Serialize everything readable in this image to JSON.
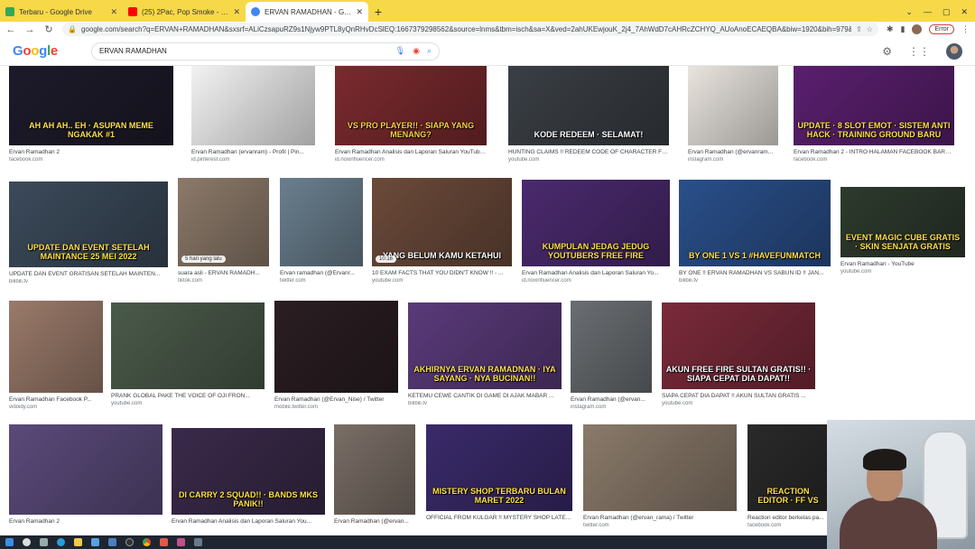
{
  "browser": {
    "tabs": [
      {
        "title": "Terbaru - Google Drive",
        "favicon_color": "#34a853"
      },
      {
        "title": "(25) 2Pac, Pop Smoke - Write Th",
        "favicon_color": "#ff0000"
      },
      {
        "title": "ERVAN RAMADHAN - Google Pe",
        "favicon_color": "#4285f4"
      }
    ],
    "new_tab": "+",
    "url": "google.com/search?q=ERVAN+RAMADHAN&sxsrf=ALiCzsapuRZ9s1Njyw9PTL8yQnRHvDcSlEQ:1667379298562&source=lnms&tbm=isch&sa=X&ved=2ahUKEwjouK_2j4_7AhWdD7cAHRcZCHYQ_AUoAnoECAEQBA&biw=1920&bih=979&dpr=1",
    "error_label": "Error"
  },
  "google": {
    "logo": [
      "G",
      "o",
      "o",
      "g",
      "l",
      "e"
    ],
    "query": "ERVAN RAMADHAN"
  },
  "results": [
    {
      "thumb_text": "AH AH AH.. EH · ASUPAN MEME NGAKAK #1",
      "caption": "Ervan Ramadhan 2",
      "source": "facebook.com",
      "bg": "#1d1b2a",
      "fg": "#ffe04a"
    },
    {
      "thumb_text": "",
      "caption": "Ervan Ramadhan (ervanram) - Profil | Pin...",
      "source": "id.pinterest.com",
      "bg": "#f2f2f2",
      "fg": "#333333"
    },
    {
      "thumb_text": "VS PRO PLAYER!! · SIAPA YANG MENANG?",
      "caption": "Ervan Ramadhan Analisis dan Laporan Saluran YouTube ...",
      "source": "id.noxinfluencer.com",
      "bg": "#7a2a2e",
      "fg": "#ffd23f"
    },
    {
      "thumb_text": "KODE REDEEM · SELAMAT!",
      "caption": "HUNTING CLAIMS !! REDEEM CODE OF CHARACTER FREE...",
      "source": "youtube.com",
      "bg": "#3a3f45",
      "fg": "#ffffff"
    },
    {
      "thumb_text": "",
      "caption": "Ervan Ramadhan (@ervanram...",
      "source": "instagram.com",
      "bg": "#e9e4de",
      "fg": "#333333"
    },
    {
      "thumb_text": "UPDATE · 8 SLOT EMOT · SISTEM ANTI HACK · TRAINING GROUND BARU",
      "caption": "Ervan Ramadhan 2 - INTRO HALAMAN FACEBOOK BARU E...",
      "source": "facebook.com",
      "bg": "#5a1f6e",
      "fg": "#ffe04a"
    },
    {
      "thumb_text": "UPDATE DAN EVENT SETELAH MAINTANCE 25 MEI 2022",
      "caption": "UPDATE DAN EVENT GRATISAN SETELAH MAINTEN...",
      "source": "bilibili.tv",
      "bg": "#3b4a5a",
      "fg": "#ffe04a"
    },
    {
      "thumb_text": "",
      "caption": "suara asli - ERVAN RAMADH...",
      "source": "tiktok.com",
      "bg": "#8c7a6a",
      "fg": "#ffffff",
      "badge": "5 hari yang lalu"
    },
    {
      "thumb_text": "",
      "caption": "Ervan ramadhan (@Ervanr...",
      "source": "twitter.com",
      "bg": "#6a7f8e",
      "fg": "#ffffff"
    },
    {
      "thumb_text": "YANG BELUM KAMU KETAHUI",
      "caption": "10 EXAM FACTS THAT YOU DIDN'T KNOW !! - ...",
      "source": "youtube.com",
      "bg": "#6b4a3a",
      "fg": "#ffffff",
      "badge": "10:16"
    },
    {
      "thumb_text": "KUMPULAN JEDAG JEDUG YOUTUBERS FREE FIRE",
      "caption": "Ervan Ramadhan Analisis dan Laporan Saluran Yo...",
      "source": "id.noxinfluencer.com",
      "bg": "#4a2a6e",
      "fg": "#ffe04a"
    },
    {
      "thumb_text": "BY ONE 1 VS 1 #HAVEFUNMATCH",
      "caption": "BY ONE !! ERVAN RAMADHAN VS SABUN ID !! JAN...",
      "source": "bilibili.tv",
      "bg": "#2a4f8a",
      "fg": "#ffe04a"
    },
    {
      "thumb_text": "EVENT MAGIC CUBE GRATIS · SKIN SENJATA GRATIS",
      "caption": "Ervan Ramadhan - YouTube",
      "source": "youtube.com",
      "bg": "#2e3a2e",
      "fg": "#ffe04a"
    },
    {
      "thumb_text": "",
      "caption": "Ervan Ramadhan Facebook P...",
      "source": "vidoidy.com",
      "bg": "#9a7a6a",
      "fg": "#ffffff"
    },
    {
      "thumb_text": "",
      "caption": "PRANK GLOBAL PAKE THE VOICE OF OJI FRON...",
      "source": "youtube.com",
      "bg": "#4a5a4a",
      "fg": "#ffffff"
    },
    {
      "thumb_text": "",
      "caption": "Ervan Ramadhan (@Ervan_Nise) / Twitter",
      "source": "mobile.twitter.com",
      "bg": "#2a1e22",
      "fg": "#ffffff"
    },
    {
      "thumb_text": "AKHIRNYA ERVAN RAMADNAN · IYA SAYANG · NYA BUCINAN!!",
      "caption": "KETEMU CEWE CANTIK DI GAME DI AJAK MABAR ...",
      "source": "bilibili.tv",
      "bg": "#5a3a7a",
      "fg": "#ffe04a"
    },
    {
      "thumb_text": "",
      "caption": "Ervan Ramadhan (@ervan...",
      "source": "instagram.com",
      "bg": "#6a6e72",
      "fg": "#ffffff"
    },
    {
      "thumb_text": "AKUN FREE FIRE SULTAN GRATIS!! · SIAPA CEPAT DIA DAPAT!!",
      "caption": "SIAPA CEPAT DIA DAPAT !! AKUN SULTAN GRATIS ...",
      "source": "youtube.com",
      "bg": "#7a2a3a",
      "fg": "#ffffff"
    },
    {
      "thumb_text": "",
      "caption": "Ervan Ramadhan 2",
      "source": "",
      "bg": "#5a4a7a",
      "fg": "#ffffff"
    },
    {
      "thumb_text": "DI CARRY 2 SQUAD!! · BANDS MKS PANIK!!",
      "caption": "Ervan Ramadhan Analisis dan Laporan Saluran You...",
      "source": "",
      "bg": "#3a2a4a",
      "fg": "#ffe04a"
    },
    {
      "thumb_text": "",
      "caption": "Ervan Ramadhan (@ervan...",
      "source": "",
      "bg": "#7a6e66",
      "fg": "#ffffff"
    },
    {
      "thumb_text": "MISTERY SHOP TERBARU BULAN MARET 2022",
      "caption": "OFFICIAL FROM KULGAR !! MYSTERY SHOP LATE...",
      "source": "",
      "bg": "#3a2a6a",
      "fg": "#ffe04a"
    },
    {
      "thumb_text": "",
      "caption": "Ervan Ramadhan (@ervan_rama) / Twitter",
      "source": "twitter.com",
      "bg": "#8a7a6a",
      "fg": "#ffffff"
    },
    {
      "thumb_text": "REACTION EDITOR · FF VS",
      "caption": "Reaction editor berkelas pa...",
      "source": "facebook.com",
      "bg": "#2a2a2a",
      "fg": "#ffe04a"
    }
  ]
}
